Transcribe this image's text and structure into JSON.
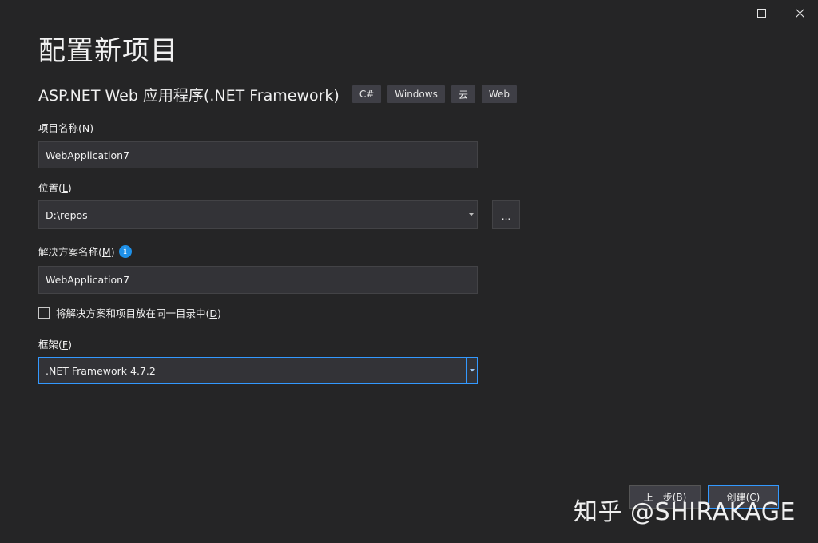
{
  "window": {
    "maximize_icon": "maximize-icon",
    "close_icon": "close-icon"
  },
  "title": "配置新项目",
  "template": {
    "name": "ASP.NET Web 应用程序(.NET Framework)",
    "tags": [
      "C#",
      "Windows",
      "云",
      "Web"
    ]
  },
  "project_name": {
    "label": "项目名称(",
    "mnemonic": "N",
    "label_end": ")",
    "value": "WebApplication7"
  },
  "location": {
    "label": "位置(",
    "mnemonic": "L",
    "label_end": ")",
    "value": "D:\\repos",
    "browse_label": "..."
  },
  "solution_name": {
    "label": "解决方案名称(",
    "mnemonic": "M",
    "label_end": ")",
    "info_icon": "info-icon",
    "value": "WebApplication7"
  },
  "same_directory": {
    "label": "将解决方案和项目放在同一目录中(",
    "mnemonic": "D",
    "label_end": ")",
    "checked": false
  },
  "framework": {
    "label": "框架(",
    "mnemonic": "F",
    "label_end": ")",
    "value": ".NET Framework 4.7.2"
  },
  "buttons": {
    "back": "上一步(B)",
    "create": "创建(C)"
  },
  "watermark": "知乎 @SHIRAKAGE",
  "colors": {
    "background": "#252526",
    "field": "#333337",
    "accent": "#3399ff",
    "info": "#1e90e8"
  }
}
